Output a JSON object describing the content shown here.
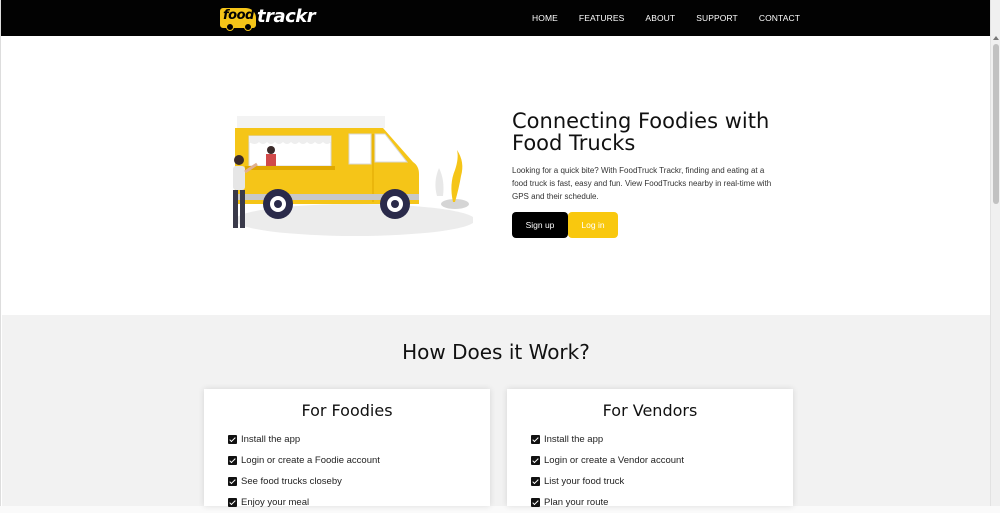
{
  "logo": {
    "part1": "food",
    "part2": "trackr"
  },
  "nav": {
    "items": [
      {
        "label": "HOME"
      },
      {
        "label": "FEATURES"
      },
      {
        "label": "ABOUT"
      },
      {
        "label": "SUPPORT"
      },
      {
        "label": "CONTACT"
      }
    ]
  },
  "hero": {
    "title": "Connecting Foodies with Food Trucks",
    "description": "Looking for a quick bite? With FoodTruck Trackr, finding and eating at a food truck is fast, easy and fun. View FoodTrucks nearby in real-time with GPS and their schedule.",
    "signup_label": "Sign up",
    "login_label": "Log in"
  },
  "how": {
    "title": "How Does it Work?",
    "foodies": {
      "title": "For Foodies",
      "steps": [
        "Install the app",
        "Login or create a Foodie account",
        "See food trucks closeby",
        "Enjoy your meal"
      ]
    },
    "vendors": {
      "title": "For Vendors",
      "steps": [
        "Install the app",
        "Login or create a Vendor account",
        "List your food truck",
        "Plan your route"
      ]
    }
  },
  "colors": {
    "nav_bg": "#020202",
    "accent_yellow": "#f9c80e",
    "button_dark": "#000000",
    "section_bg": "#f2f2f2"
  }
}
